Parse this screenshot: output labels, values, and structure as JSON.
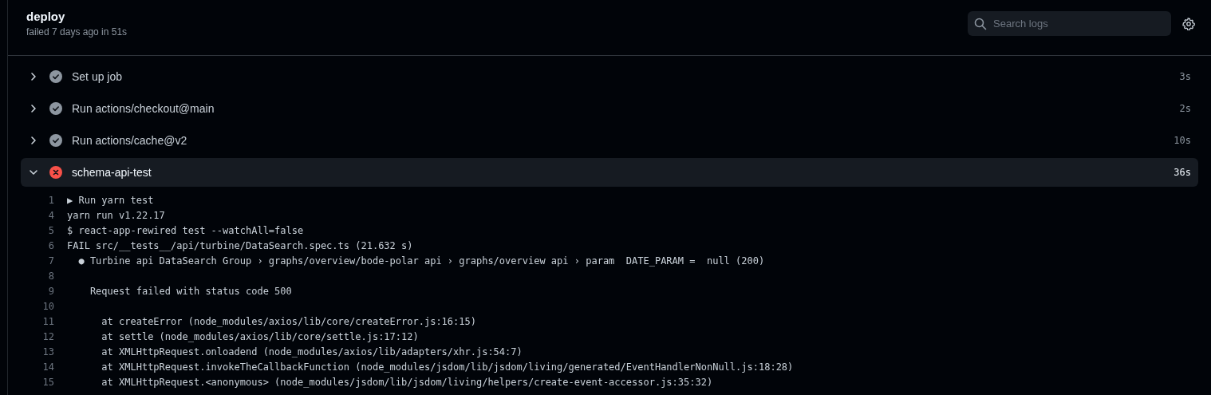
{
  "job": {
    "title": "deploy",
    "summary": "failed 7 days ago in 51s"
  },
  "search": {
    "placeholder": "Search logs"
  },
  "steps": [
    {
      "name": "Set up job",
      "duration": "3s",
      "failed": false,
      "expanded": false
    },
    {
      "name": "Run actions/checkout@main",
      "duration": "2s",
      "failed": false,
      "expanded": false
    },
    {
      "name": "Run actions/cache@v2",
      "duration": "10s",
      "failed": false,
      "expanded": false
    },
    {
      "name": "schema-api-test",
      "duration": "36s",
      "failed": true,
      "expanded": true
    }
  ],
  "log_lines": [
    {
      "number": "1",
      "text": "▶ Run yarn test"
    },
    {
      "number": "4",
      "text": "yarn run v1.22.17"
    },
    {
      "number": "5",
      "text": "$ react-app-rewired test --watchAll=false"
    },
    {
      "number": "6",
      "text": "FAIL src/__tests__/api/turbine/DataSearch.spec.ts (21.632 s)"
    },
    {
      "number": "7",
      "text": "  ● Turbine api DataSearch Group › graphs/overview/bode-polar api › graphs/overview api › param  DATE_PARAM =  null (200)"
    },
    {
      "number": "8"
    },
    {
      "number": "9",
      "text": "    Request failed with status code 500"
    },
    {
      "number": "10"
    },
    {
      "number": "11",
      "text": "      at createError (node_modules/axios/lib/core/createError.js:16:15)"
    },
    {
      "number": "12",
      "text": "      at settle (node_modules/axios/lib/core/settle.js:17:12)"
    },
    {
      "number": "13",
      "text": "      at XMLHttpRequest.onloadend (node_modules/axios/lib/adapters/xhr.js:54:7)"
    },
    {
      "number": "14",
      "text": "      at XMLHttpRequest.invokeTheCallbackFunction (node_modules/jsdom/lib/jsdom/living/generated/EventHandlerNonNull.js:18:28)"
    },
    {
      "number": "15",
      "text": "      at XMLHttpRequest.<anonymous> (node_modules/jsdom/lib/jsdom/living/helpers/create-event-accessor.js:35:32)"
    }
  ]
}
